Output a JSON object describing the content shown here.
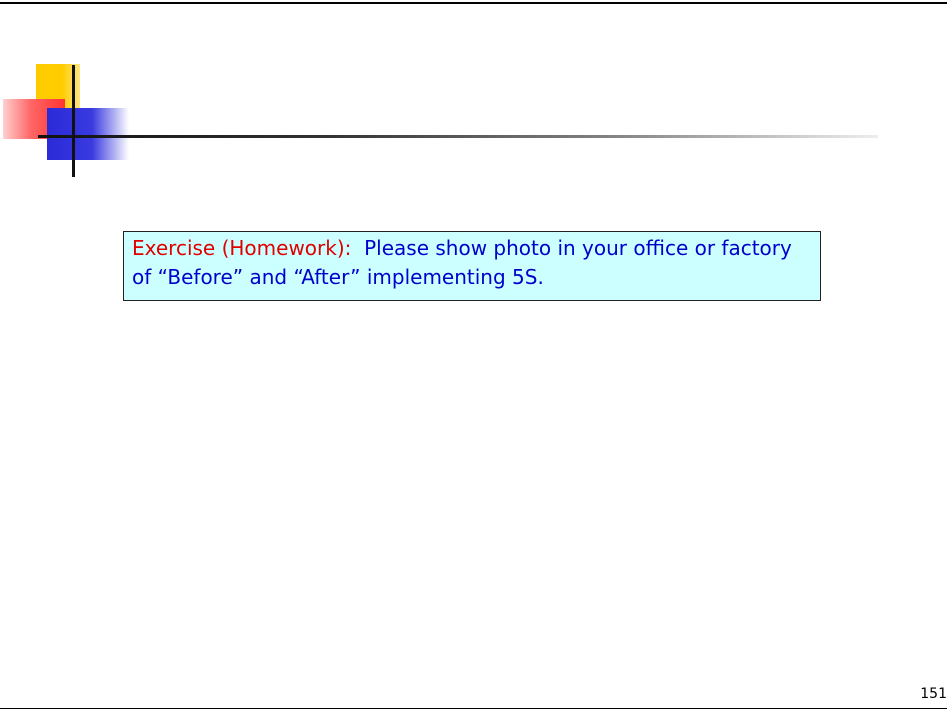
{
  "exercise": {
    "label": "Exercise (Homework):",
    "text": "Please show photo in your office or factory of “Before” and “After” implementing 5S."
  },
  "slide_number": "151",
  "colors": {
    "label_red": "#e00000",
    "text_blue": "#0000cc",
    "box_background": "#ccffff",
    "deco_yellow": "#ffcc00",
    "deco_red": "#ff3333",
    "deco_blue": "#2a2ad8"
  }
}
